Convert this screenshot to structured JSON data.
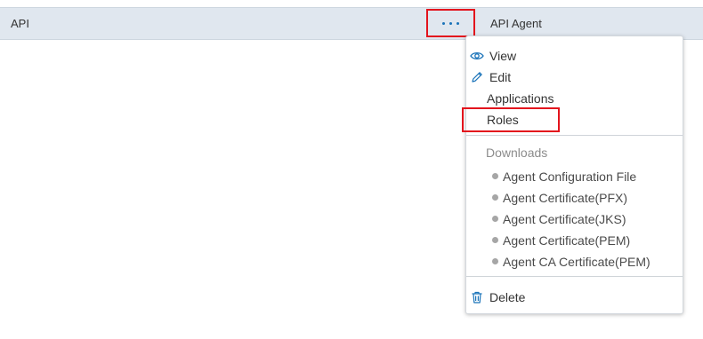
{
  "table": {
    "row": {
      "name": "API",
      "type": "API Agent"
    },
    "more_button_icon": "more-dots-icon"
  },
  "menu": {
    "view_label": "View",
    "edit_label": "Edit",
    "applications_label": "Applications",
    "roles_label": "Roles",
    "downloads_header": "Downloads",
    "downloads": [
      "Agent Configuration File",
      "Agent Certificate(PFX)",
      "Agent Certificate(JKS)",
      "Agent Certificate(PEM)",
      "Agent CA Certificate(PEM)"
    ],
    "delete_label": "Delete",
    "icons": {
      "view": "eye-icon",
      "edit": "pencil-icon",
      "delete": "trash-icon"
    }
  },
  "colors": {
    "accent": "#1a73b9",
    "highlight": "#e3141d",
    "row_bg": "#e0e7ef"
  }
}
